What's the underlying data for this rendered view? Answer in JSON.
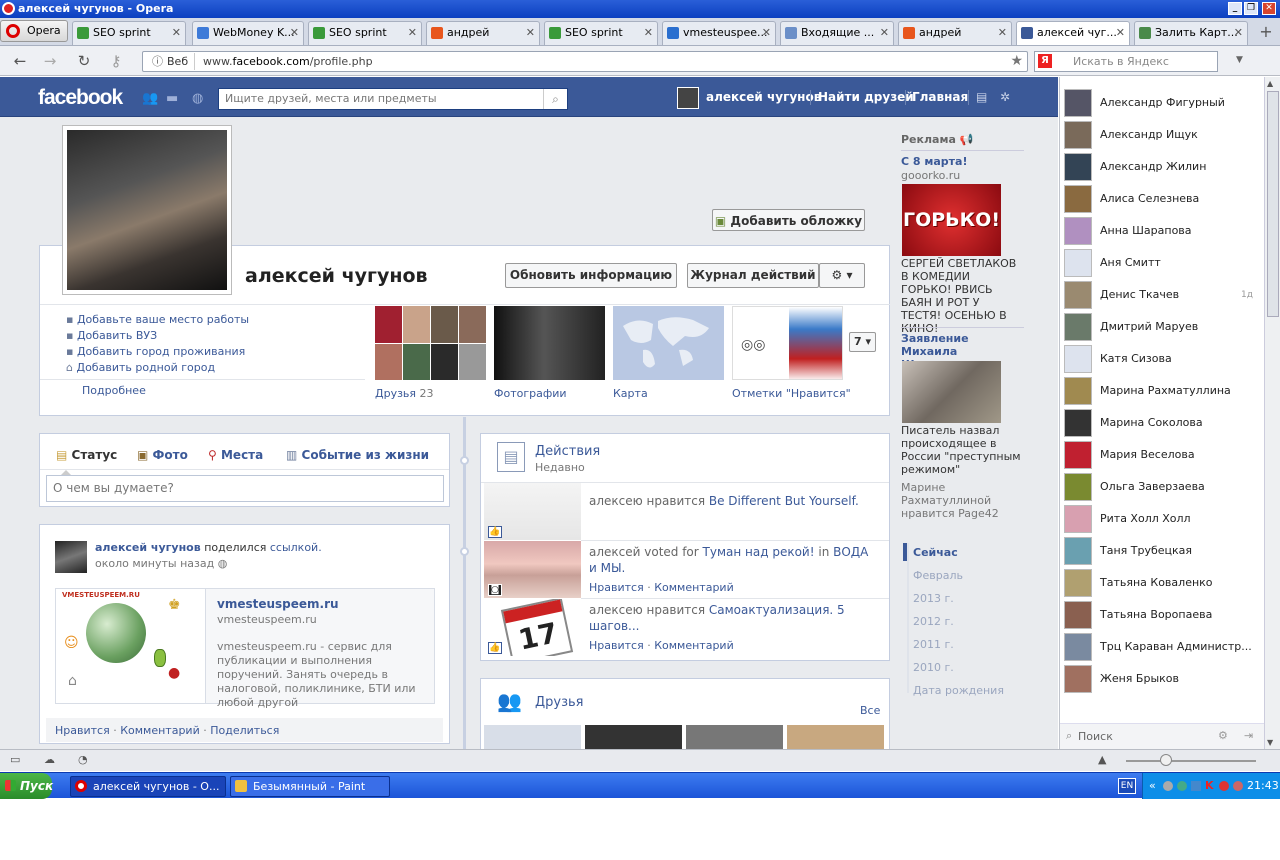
{
  "window": {
    "title": "алексей чугунов - Opera"
  },
  "browser": {
    "menu_label": "Opera",
    "tabs": [
      {
        "label": "SEO sprint",
        "color": "#3a9a3a"
      },
      {
        "label": "WebMoney K...",
        "color": "#3d7ad8"
      },
      {
        "label": "SEO sprint",
        "color": "#3a9a3a"
      },
      {
        "label": "андрей",
        "color": "#e8561d"
      },
      {
        "label": "SEO sprint",
        "color": "#3a9a3a"
      },
      {
        "label": "vmesteuspee...",
        "color": "#2a6fcf"
      },
      {
        "label": "Входящие ...",
        "color": "#6b8fc8"
      },
      {
        "label": "андрей",
        "color": "#e8561d"
      },
      {
        "label": "алексей чуг...",
        "color": "#3b5998"
      },
      {
        "label": "Залить Карт...",
        "color": "#4a8a4a"
      }
    ],
    "url_prefix": "www.",
    "url_domain": "facebook.com",
    "url_path": "/profile.php",
    "web_label": "Веб",
    "search_placeholder": "Искать в Яндекс",
    "yandex_letter": "Я"
  },
  "fb": {
    "logo": "facebook",
    "search_placeholder": "Ищите друзей, места или предметы",
    "nav": {
      "user": "алексей чугунов",
      "find_friends": "Найти друзей",
      "home": "Главная"
    },
    "profile": {
      "name": "алексей чугунов",
      "add_cover": "Добавить обложку",
      "update_info": "Обновить информацию",
      "activity_log": "Журнал действий",
      "about": [
        "Добавьте ваше место работы",
        "Добавить ВУЗ",
        "Добавить город проживания",
        "Добавить родной город"
      ],
      "more": "Подробнее",
      "apps": [
        {
          "label": "Друзья",
          "count": "23"
        },
        {
          "label": "Фотографии"
        },
        {
          "label": "Карта"
        },
        {
          "label": "Отметки \"Нравится\""
        }
      ],
      "apps_more": "7"
    },
    "composer": {
      "tabs": [
        "Статус",
        "Фото",
        "Места",
        "Событие из жизни"
      ],
      "placeholder": "О чем вы думаете?"
    },
    "post": {
      "author": "алексей чугунов",
      "action": "поделился",
      "link_word": "ссылкой.",
      "time": "около минуты назад",
      "preview_image_text": "VMESTEUSPEEM.RU",
      "link_title": "vmesteuspeem.ru",
      "link_domain": "vmesteuspeem.ru",
      "link_desc": "vmesteuspeem.ru - сервис для публикации и выполнения поручений. Занять очередь в налоговой, поликлинике, БТИ или любой другой",
      "actions": [
        "Нравится",
        "Комментарий",
        "Поделиться"
      ]
    },
    "activity": {
      "title": "Действия",
      "subtitle": "Недавно",
      "items": [
        {
          "pre": "алексею нравится ",
          "link": "Be Different But Yourself.",
          "post": "",
          "actions": []
        },
        {
          "pre": "алексей voted for ",
          "link": "Туман над рекой!",
          "post": " in ",
          "link2": "ВОДА и МЫ.",
          "actions": [
            "Нравится",
            "Комментарий"
          ]
        },
        {
          "pre": "алексею нравится ",
          "link": "Самоактуализация. 5 шагов...",
          "post": "",
          "actions": [
            "Нравится",
            "Комментарий"
          ]
        }
      ]
    },
    "friends_box": {
      "title": "Друзья",
      "all": "Все"
    },
    "ads": {
      "header": "Реклама",
      "items": [
        {
          "title": "С 8 марта!",
          "domain": "gooorko.ru",
          "image_text": "ГОРЬКО!",
          "desc": "СЕРГЕЙ СВЕТЛАКОВ В КОМЕДИИ ГОРЬКО! РВИСЬ БАЯН И РОТ У ТЕСТЯ! ОСЕНЬЮ В КИНО!"
        },
        {
          "title": "Заявление Михаила Шишкина",
          "desc": "Писатель назвал происходящее в России \"преступным режимом\"",
          "social": "Марине Рахматуллиной нравится Page42"
        }
      ]
    },
    "timeline_nav": [
      "Сейчас",
      "Февраль",
      "2013 г.",
      "2012 г.",
      "2011 г.",
      "2010 г.",
      "Дата рождения"
    ]
  },
  "chat": {
    "friends": [
      {
        "name": "Александр Фигурный",
        "color": "#556"
      },
      {
        "name": "Александр Ищук",
        "color": "#7a6a5a"
      },
      {
        "name": "Александр Жилин",
        "color": "#345"
      },
      {
        "name": "Алиса Селезнева",
        "color": "#8a6a40"
      },
      {
        "name": "Анна Шарапова",
        "color": "#b090c0"
      },
      {
        "name": "Аня Смитт",
        "color": "#dde3ee"
      },
      {
        "name": "Денис Ткачев",
        "color": "#9a8a70",
        "badge": "1д"
      },
      {
        "name": "Дмитрий Маруев",
        "color": "#6a7a6a"
      },
      {
        "name": "Катя Сизова",
        "color": "#dde3ee"
      },
      {
        "name": "Марина Рахматуллина",
        "color": "#a08a50"
      },
      {
        "name": "Марина Соколова",
        "color": "#333"
      },
      {
        "name": "Мария Веселова",
        "color": "#c02030"
      },
      {
        "name": "Ольга Заверзаева",
        "color": "#7a8a30"
      },
      {
        "name": "Рита Холл Холл",
        "color": "#d8a0b0"
      },
      {
        "name": "Таня Трубецкая",
        "color": "#6aa0b0"
      },
      {
        "name": "Татьяна Коваленко",
        "color": "#b0a070"
      },
      {
        "name": "Татьяна Воропаева",
        "color": "#8a6050"
      },
      {
        "name": "Трц Караван Администр...",
        "color": "#7a8aa0"
      },
      {
        "name": "Женя Брыков",
        "color": "#a07060"
      }
    ],
    "search_placeholder": "Поиск"
  },
  "taskbar": {
    "start": "Пуск",
    "tasks": [
      "алексей чугунов - О...",
      "Безымянный - Paint"
    ],
    "lang": "EN",
    "clock": "21:43"
  }
}
